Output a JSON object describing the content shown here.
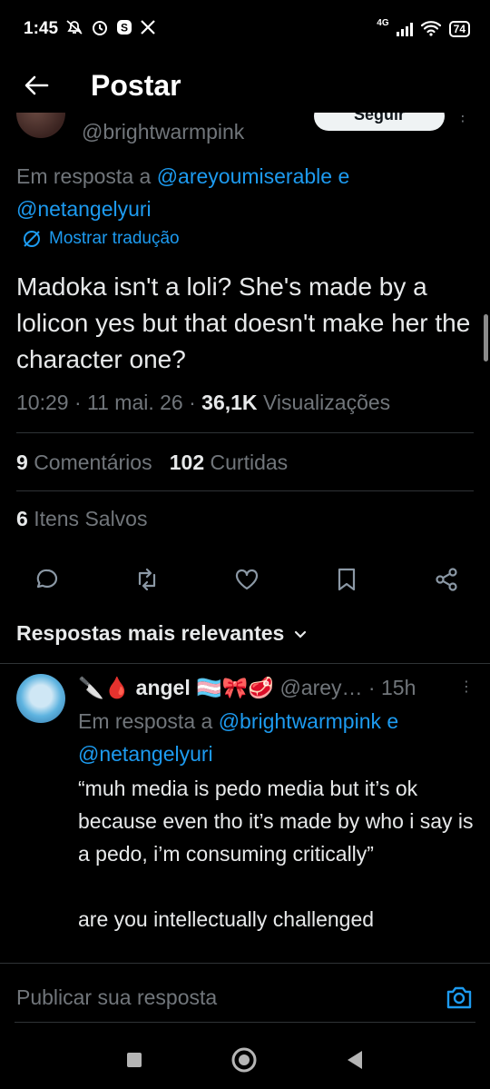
{
  "status_bar": {
    "time": "1:45",
    "network": "4G",
    "battery": "74",
    "icons": [
      "mute-icon",
      "alarm-icon",
      "s-app-icon",
      "x-logo-icon",
      "signal-icon",
      "wifi-icon",
      "battery-icon"
    ]
  },
  "header": {
    "title": "Postar"
  },
  "post": {
    "handle": "@brightwarmpink",
    "follow_label": "Seguir",
    "reply_prefix": "Em resposta a ",
    "reply_mention_1": "@areyoumiserable",
    "reply_join": " e ",
    "reply_mention_2": "@netangelyuri",
    "translate_label": "Mostrar tradução",
    "text": "Madoka isn't a loli? She's made by a lolicon yes but that doesn't make her the character one?",
    "time": "10:29",
    "date": "11 mai. 26",
    "views_count": "36,1K",
    "views_label": "Visualizações",
    "comments_count": "9",
    "comments_label": "Comentários",
    "likes_count": "102",
    "likes_label": "Curtidas",
    "saves_count": "6",
    "saves_label": "Itens Salvos"
  },
  "replies_header": {
    "label": "Respostas mais relevantes"
  },
  "reply": {
    "name": "angel",
    "handle": "@arey…",
    "age": "15h",
    "reply_prefix": "Em resposta a ",
    "reply_mention_1": "@brightwarmpink",
    "reply_join": " e ",
    "reply_mention_2": "@netangelyuri",
    "text": "“muh media is pedo media but it’s ok because even tho it’s made by who i say is a pedo, i’m consuming critically”\n\nare you intellectually challenged"
  },
  "compose": {
    "placeholder": "Publicar sua resposta"
  },
  "colors": {
    "accent": "#1d9bf0",
    "background": "#000000",
    "muted": "#71767b",
    "text": "#e7e9ea",
    "divider": "#2f3336"
  }
}
